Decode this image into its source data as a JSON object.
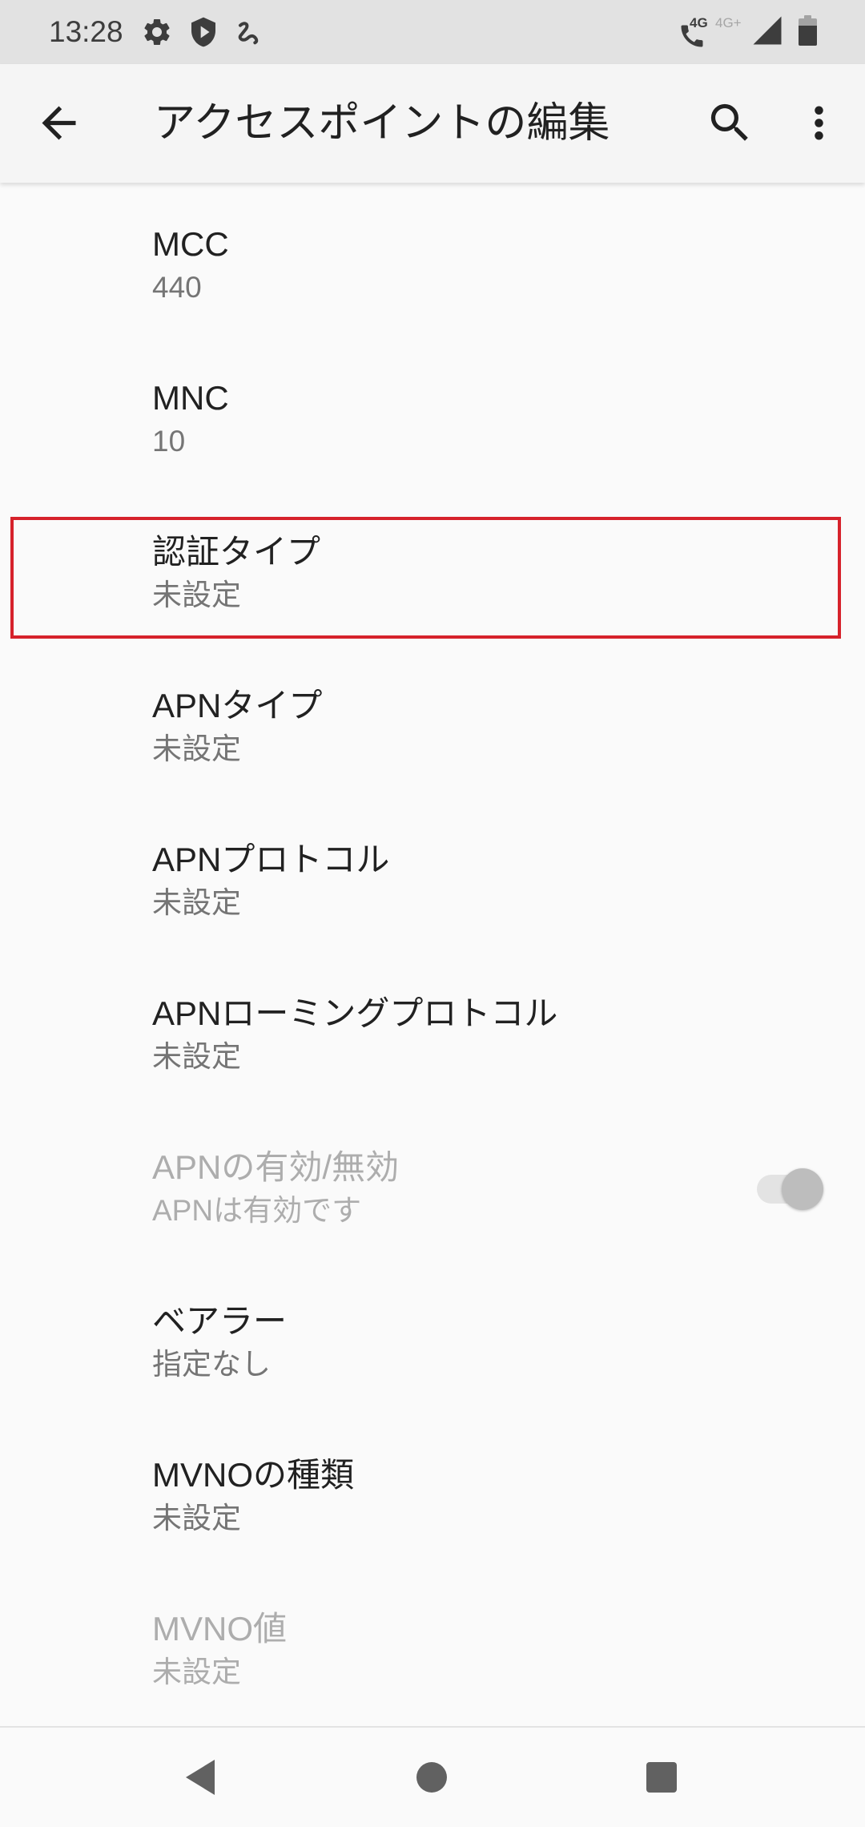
{
  "status_bar": {
    "time": "13:28",
    "volte_label": "4G",
    "network_label": "4G+",
    "battery_level": 0.75,
    "icons": {
      "settings": "gear-icon",
      "play_protect": "shield-play-icon",
      "notification": "squiggle-icon",
      "call": "phone-icon",
      "signal": "signal-icon",
      "battery": "battery-icon"
    }
  },
  "app_bar": {
    "title": "アクセスポイントの編集",
    "icons": {
      "back": "arrow-back-icon",
      "search": "search-icon",
      "more": "more-vert-icon"
    }
  },
  "preferences": [
    {
      "title": "MCC",
      "summary": "440",
      "enabled": true
    },
    {
      "title": "MNC",
      "summary": "10",
      "enabled": true
    },
    {
      "title": "認証タイプ",
      "summary": "未設定",
      "enabled": true
    },
    {
      "title": "APNタイプ",
      "summary": "未設定",
      "enabled": true
    },
    {
      "title": "APNプロトコル",
      "summary": "未設定",
      "enabled": true
    },
    {
      "title": "APNローミングプロトコル",
      "summary": "未設定",
      "enabled": true
    },
    {
      "title": "APNの有効/無効",
      "summary": "APNは有効です",
      "enabled": false,
      "switch": {
        "checked": true
      }
    },
    {
      "title": "ベアラー",
      "summary": "指定なし",
      "enabled": true
    },
    {
      "title": "MVNOの種類",
      "summary": "未設定",
      "enabled": true
    },
    {
      "title": "MVNO値",
      "summary": "未設定",
      "enabled": false
    }
  ],
  "nav_bar": {
    "icons": {
      "back": "nav-back-icon",
      "home": "nav-home-icon",
      "recents": "nav-recents-icon"
    }
  },
  "colors": {
    "status_bar_bg": "#e2e2e2",
    "status_bar_fg": "#3d3d3d",
    "status_bar_dim": "#a6a6a6",
    "app_bar_bg": "#f5f5f5",
    "page_bg": "#fafafa",
    "text_primary": "#212121",
    "text_secondary": "#757575",
    "text_disabled": "#adadad",
    "icon": "#212121",
    "nav_icon": "#616161",
    "switch_track": "#e3e3e3",
    "switch_thumb": "#bdbdbd",
    "highlight": "#d6222b"
  }
}
